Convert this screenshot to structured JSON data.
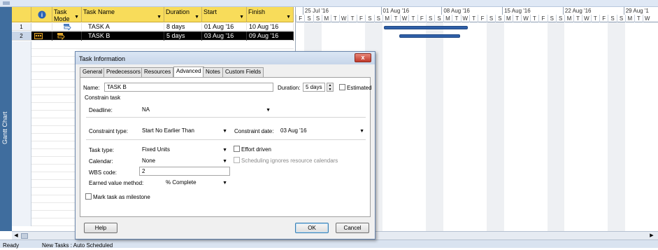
{
  "side_tab_label": "Gantt Chart",
  "grid": {
    "headers": {
      "info_icon": "info-icon",
      "task_mode": "Task\nMode",
      "task_name": "Task Name",
      "duration": "Duration",
      "start": "Start",
      "finish": "Finish"
    },
    "rows": [
      {
        "id": "1",
        "name": "TASK A",
        "duration": "8 days",
        "start": "01 Aug '16",
        "finish": "10 Aug '16"
      },
      {
        "id": "2",
        "name": "TASK B",
        "duration": "5 days",
        "start": "03 Aug '16",
        "finish": "09 Aug '16"
      }
    ]
  },
  "gantt": {
    "weeks": [
      "25 Jul '16",
      "01 Aug '16",
      "08 Aug '16",
      "15 Aug '16",
      "22 Aug '16",
      "29 Aug '1"
    ],
    "day_letters": [
      "F",
      "S",
      "S",
      "M",
      "T",
      "W",
      "T",
      "F",
      "S",
      "S",
      "M",
      "T",
      "W",
      "T",
      "F",
      "S",
      "S",
      "M",
      "T",
      "W",
      "T",
      "F",
      "S",
      "S",
      "M",
      "T",
      "W",
      "T",
      "F",
      "S",
      "S",
      "M",
      "T",
      "W",
      "T",
      "F",
      "S",
      "S",
      "M",
      "T",
      "W"
    ],
    "bar_color": "#2f5fa8"
  },
  "dialog": {
    "title": "Task Information",
    "close_label": "x",
    "tabs": [
      "General",
      "Predecessors",
      "Resources",
      "Advanced",
      "Notes",
      "Custom Fields"
    ],
    "active_tab": "Advanced",
    "name_label": "Name:",
    "name_value": "TASK B",
    "duration_label": "Duration:",
    "duration_value": "5 days",
    "estimated_label": "Estimated",
    "constrain_heading": "Constrain task",
    "deadline_label": "Deadline:",
    "deadline_value": "NA",
    "constraint_type_label": "Constraint type:",
    "constraint_type_value": "Start No Earlier Than",
    "constraint_date_label": "Constraint date:",
    "constraint_date_value": "03 Aug '16",
    "task_type_label": "Task type:",
    "task_type_value": "Fixed Units",
    "effort_driven_label": "Effort driven",
    "calendar_label": "Calendar:",
    "calendar_value": "None",
    "scheduling_ignores_label": "Scheduling ignores resource calendars",
    "wbs_label": "WBS code:",
    "wbs_value": "2",
    "earned_value_label": "Earned value method:",
    "earned_value_value": "% Complete",
    "milestone_label": "Mark task as milestone",
    "help_label": "Help",
    "ok_label": "OK",
    "cancel_label": "Cancel"
  },
  "status": {
    "ready": "Ready",
    "new_tasks": "New Tasks : Auto Scheduled"
  }
}
